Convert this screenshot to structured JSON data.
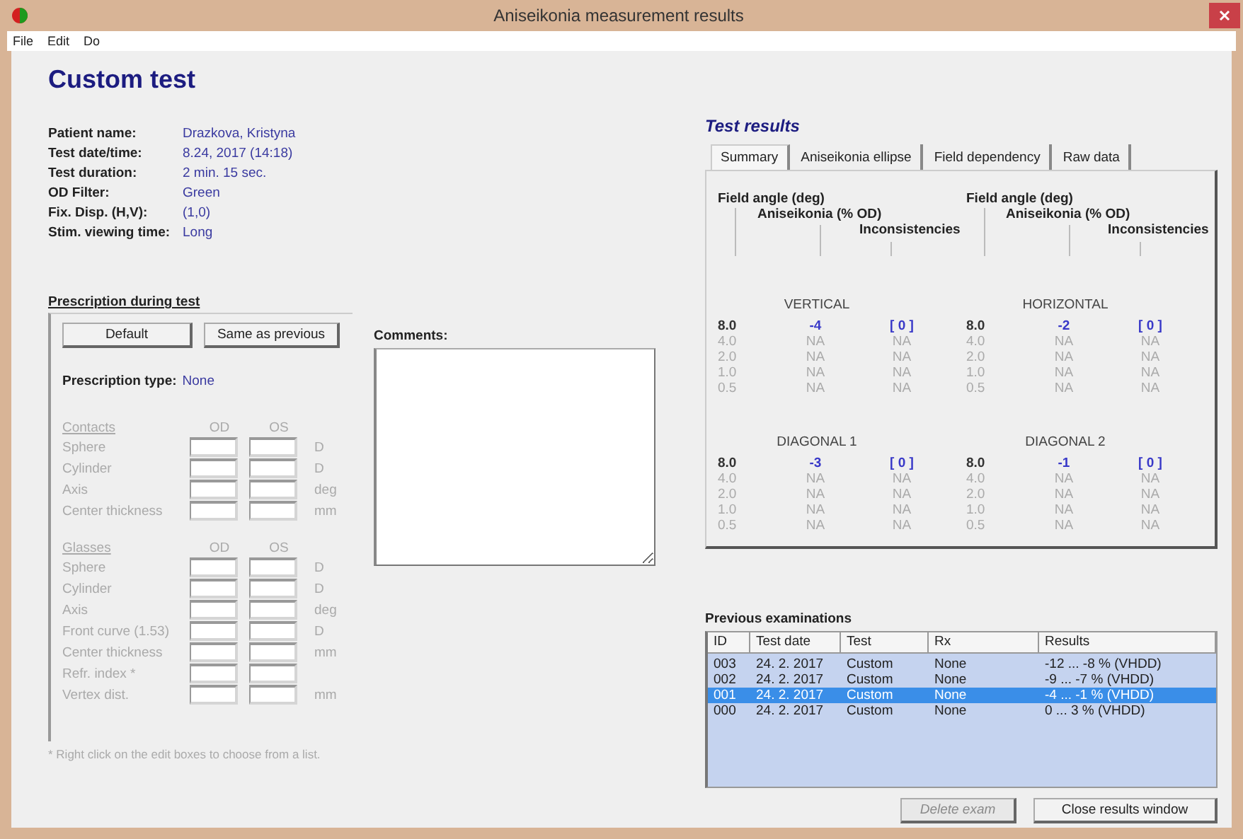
{
  "window": {
    "title": "Aniseikonia measurement results"
  },
  "menu": [
    "File",
    "Edit",
    "Do"
  ],
  "heading": "Custom test",
  "patient_info": [
    {
      "label": "Patient name:",
      "value": "Drazkova, Kristyna"
    },
    {
      "label": "Test date/time:",
      "value": "8.24, 2017  (14:18)"
    },
    {
      "label": "Test duration:",
      "value": "2 min. 15 sec."
    },
    {
      "label": "OD Filter:",
      "value": "Green"
    },
    {
      "label": "Fix. Disp. (H,V):",
      "value": "(1,0)"
    },
    {
      "label": "Stim. viewing time:",
      "value": "Long"
    }
  ],
  "prescription": {
    "title": "Prescription during test",
    "buttons": [
      "Default",
      "Same as previous"
    ],
    "type_label": "Prescription type:",
    "type_value": "None",
    "sections": [
      {
        "title": "Contacts",
        "disabled": true,
        "columns": [
          "OD",
          "OS"
        ],
        "rows": [
          {
            "label": "Sphere",
            "unit": "D"
          },
          {
            "label": "Cylinder",
            "unit": "D"
          },
          {
            "label": "Axis",
            "unit": "deg"
          },
          {
            "label": "Center thickness",
            "unit": "mm"
          }
        ]
      },
      {
        "title": "Glasses",
        "disabled": true,
        "columns": [
          "OD",
          "OS"
        ],
        "rows": [
          {
            "label": "Sphere",
            "unit": "D"
          },
          {
            "label": "Cylinder",
            "unit": "D"
          },
          {
            "label": "Axis",
            "unit": "deg"
          },
          {
            "label": "Front curve (1.53)",
            "unit": "D"
          },
          {
            "label": "Center thickness",
            "unit": "mm"
          },
          {
            "label": "Refr. index *"
          },
          {
            "label": "Vertex dist.",
            "unit": "mm"
          }
        ]
      }
    ],
    "footnote": "* Right click on the edit boxes to choose from a list."
  },
  "comments": {
    "label": "Comments:"
  },
  "results": {
    "title": "Test results",
    "tabs": [
      {
        "label": "Summary",
        "selected": true
      },
      {
        "label": "Aniseikonia ellipse",
        "selected": false
      },
      {
        "label": "Field dependency",
        "selected": false
      },
      {
        "label": "Raw data",
        "selected": false
      }
    ],
    "summary_headers": [
      [
        "Field angle (deg)",
        "Aniseikonia (% OD)",
        "Inconsistencies"
      ],
      [
        "Field angle (deg)",
        "Aniseikonia (% OD)",
        "Inconsistencies"
      ]
    ],
    "groups": [
      {
        "name": "VERTICAL",
        "rows": [
          {
            "angle": "8.0",
            "value": "-4",
            "inconsistency": "[ 0 ]",
            "measured": true
          },
          {
            "angle": "4.0",
            "value": "NA",
            "inconsistency": "NA",
            "measured": false
          },
          {
            "angle": "2.0",
            "value": "NA",
            "inconsistency": "NA",
            "measured": false
          },
          {
            "angle": "1.0",
            "value": "NA",
            "inconsistency": "NA",
            "measured": false
          },
          {
            "angle": "0.5",
            "value": "NA",
            "inconsistency": "NA",
            "measured": false
          }
        ]
      },
      {
        "name": "HORIZONTAL",
        "rows": [
          {
            "angle": "8.0",
            "value": "-2",
            "inconsistency": "[ 0 ]",
            "measured": true
          },
          {
            "angle": "4.0",
            "value": "NA",
            "inconsistency": "NA",
            "measured": false
          },
          {
            "angle": "2.0",
            "value": "NA",
            "inconsistency": "NA",
            "measured": false
          },
          {
            "angle": "1.0",
            "value": "NA",
            "inconsistency": "NA",
            "measured": false
          },
          {
            "angle": "0.5",
            "value": "NA",
            "inconsistency": "NA",
            "measured": false
          }
        ]
      },
      {
        "name": "DIAGONAL 1",
        "rows": [
          {
            "angle": "8.0",
            "value": "-3",
            "inconsistency": "[ 0 ]",
            "measured": true
          },
          {
            "angle": "4.0",
            "value": "NA",
            "inconsistency": "NA",
            "measured": false
          },
          {
            "angle": "2.0",
            "value": "NA",
            "inconsistency": "NA",
            "measured": false
          },
          {
            "angle": "1.0",
            "value": "NA",
            "inconsistency": "NA",
            "measured": false
          },
          {
            "angle": "0.5",
            "value": "NA",
            "inconsistency": "NA",
            "measured": false
          }
        ]
      },
      {
        "name": "DIAGONAL 2",
        "rows": [
          {
            "angle": "8.0",
            "value": "-1",
            "inconsistency": "[ 0 ]",
            "measured": true
          },
          {
            "angle": "4.0",
            "value": "NA",
            "inconsistency": "NA",
            "measured": false
          },
          {
            "angle": "2.0",
            "value": "NA",
            "inconsistency": "NA",
            "measured": false
          },
          {
            "angle": "1.0",
            "value": "NA",
            "inconsistency": "NA",
            "measured": false
          },
          {
            "angle": "0.5",
            "value": "NA",
            "inconsistency": "NA",
            "measured": false
          }
        ]
      }
    ]
  },
  "previous": {
    "title": "Previous examinations",
    "columns": [
      "ID",
      "Test date",
      "Test",
      "Rx",
      "Results"
    ],
    "rows": [
      {
        "cells": [
          "003",
          "24. 2. 2017",
          "Custom",
          "None",
          "-12 ... -8 % (VHDD)"
        ],
        "selected": false
      },
      {
        "cells": [
          "002",
          "24. 2. 2017",
          "Custom",
          "None",
          "-9 ... -7 % (VHDD)"
        ],
        "selected": false
      },
      {
        "cells": [
          "001",
          "24. 2. 2017",
          "Custom",
          "None",
          "-4 ... -1 % (VHDD)"
        ],
        "selected": true
      },
      {
        "cells": [
          "000",
          "24. 2. 2017",
          "Custom",
          "None",
          "0 ... 3 % (VHDD)"
        ],
        "selected": false
      }
    ]
  },
  "buttons": [
    {
      "label": "Delete exam",
      "disabled": true
    },
    {
      "label": "Close results window",
      "disabled": false
    }
  ]
}
